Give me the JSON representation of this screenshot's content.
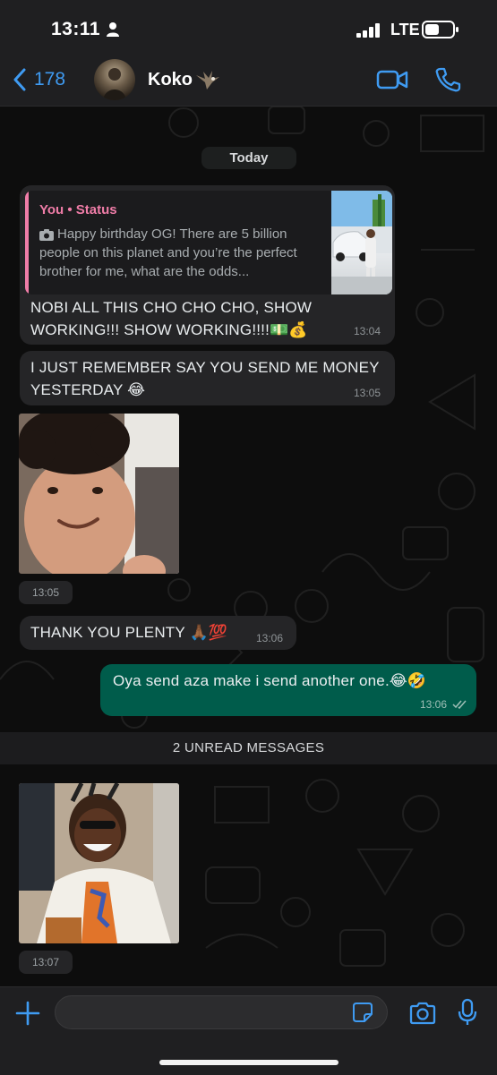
{
  "status_bar": {
    "time": "13:11",
    "network": "LTE"
  },
  "header": {
    "back_count": "178",
    "contact_name": "Koko"
  },
  "chat": {
    "date_label": "Today",
    "messages": [
      {
        "quote_author": "You • Status",
        "quote_text": "Happy birthday OG! There are 5 billion people on this planet and you’re the perfect brother for me, what are the odds...",
        "text": "NOBI ALL THIS CHO CHO CHO, SHOW WORKING!!! SHOW WORKING!!!!💵💰",
        "time": "13:04"
      },
      {
        "text": "I JUST REMEMBER SAY YOU SEND ME MONEY YESTERDAY 😂",
        "time": "13:05"
      },
      {
        "time": "13:05"
      },
      {
        "text": "THANK YOU PLENTY 🙏🏾💯",
        "time": "13:06"
      },
      {
        "text": "Oya send aza make i send another one.😂🤣",
        "time": "13:06"
      },
      {
        "time": "13:07"
      }
    ],
    "unread_label": "2 UNREAD MESSAGES"
  },
  "composer": {
    "input_value": ""
  },
  "colors": {
    "accent_blue": "#3f9bf2",
    "outgoing_bubble": "#005c4b",
    "incoming_bubble": "#252527",
    "quote_author": "#f07da8"
  },
  "icons": [
    "back-chevron-icon",
    "video-call-icon",
    "phone-icon",
    "plus-icon",
    "sticker-icon",
    "camera-icon",
    "microphone-icon",
    "double-check-icon"
  ]
}
